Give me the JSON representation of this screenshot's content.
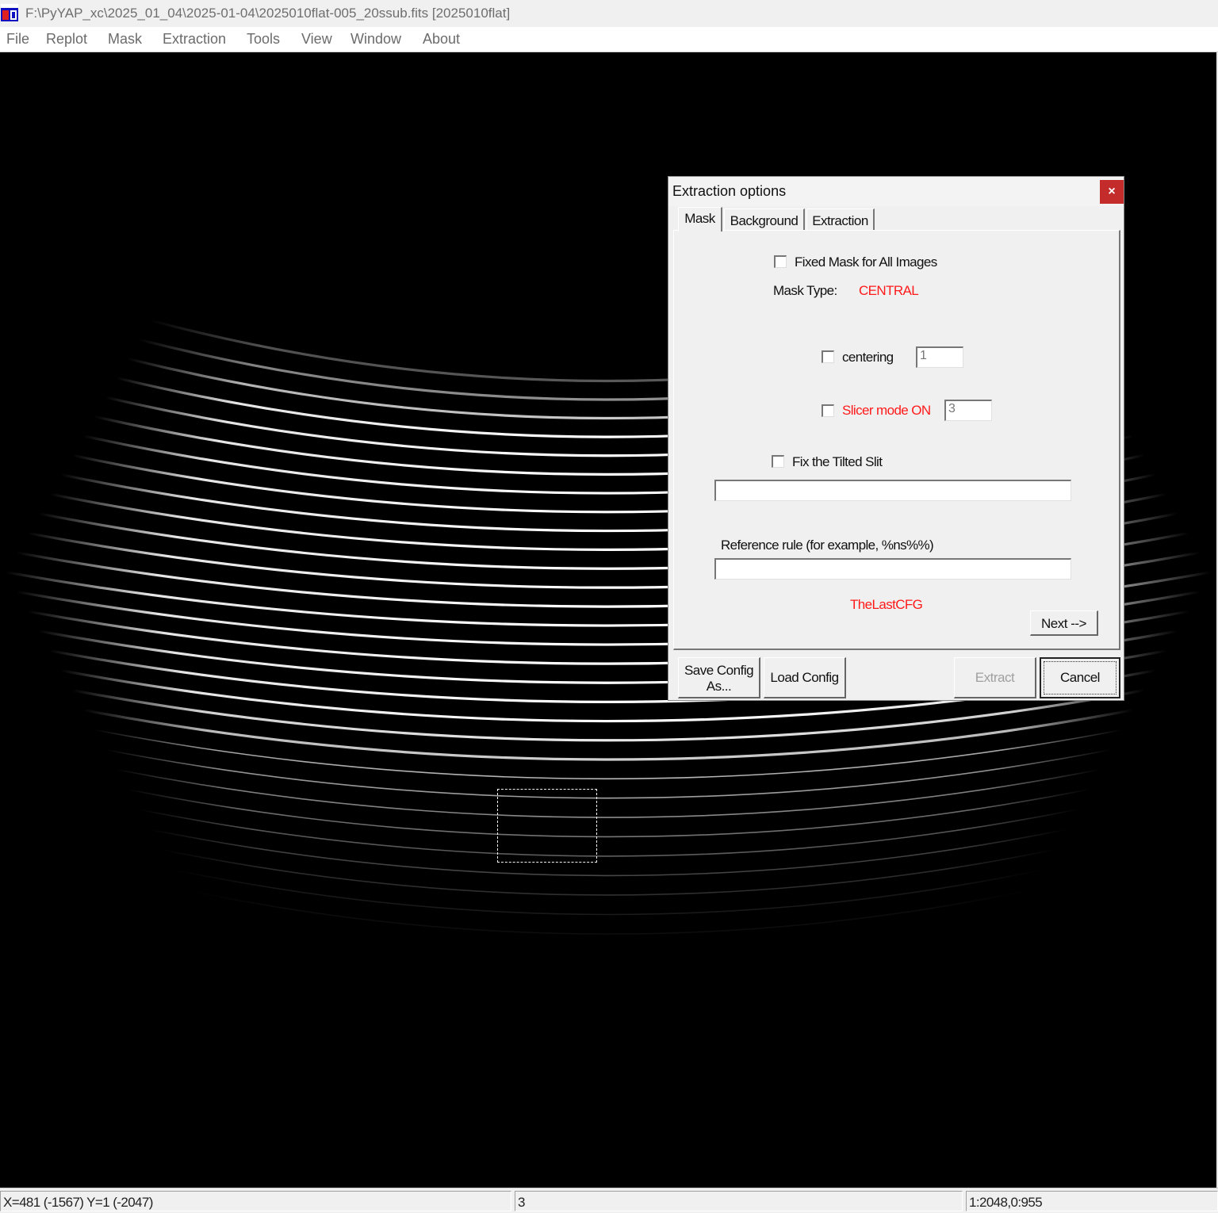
{
  "window": {
    "title": "F:\\PyYAP_xc\\2025_01_04\\2025-01-04\\2025010flat-005_20ssub.fits [2025010flat]",
    "app_icon": "pyyap-app-icon"
  },
  "menubar": {
    "items": [
      "File",
      "Replot",
      "Mask",
      "Extraction",
      "Tools",
      "View",
      "Window",
      "About"
    ]
  },
  "image_view": {
    "content": "echelle-flat-field-orders",
    "selection_style": "dashed-rectangle"
  },
  "statusbar": {
    "coords": "X=481 (-1567) Y=1 (-2047)",
    "value": "3",
    "scale": "1:2048,0:955"
  },
  "dialog": {
    "title": "Extraction options",
    "close_glyph": "×",
    "tabs": [
      "Mask",
      "Background",
      "Extraction"
    ],
    "active_tab": "Mask",
    "fixed_mask_label": "Fixed Mask for All Images",
    "fixed_mask_checked": false,
    "mask_type_label": "Mask Type:",
    "mask_type_value": "CENTRAL",
    "centering_label": "centering",
    "centering_checked": false,
    "centering_value": "1",
    "slicer_label": "Slicer mode ON",
    "slicer_checked": false,
    "slicer_value": "3",
    "tilted_slit_label": "Fix the Tilted Slit",
    "tilted_slit_checked": false,
    "tilted_slit_value": "",
    "reference_rule_label": "Reference rule (for example, %ns%%)",
    "reference_rule_value": "",
    "config_name": "TheLastCFG",
    "next_button": "Next -->",
    "save_config_line1": "Save Config",
    "save_config_line2": "As...",
    "load_config_button": "Load  Config",
    "extract_button": "Extract",
    "extract_enabled": false,
    "cancel_button": "Cancel"
  },
  "colors": {
    "accent_red": "#ff1a1a",
    "close_button": "#c42b2b",
    "canvas_bg": "#000000"
  }
}
